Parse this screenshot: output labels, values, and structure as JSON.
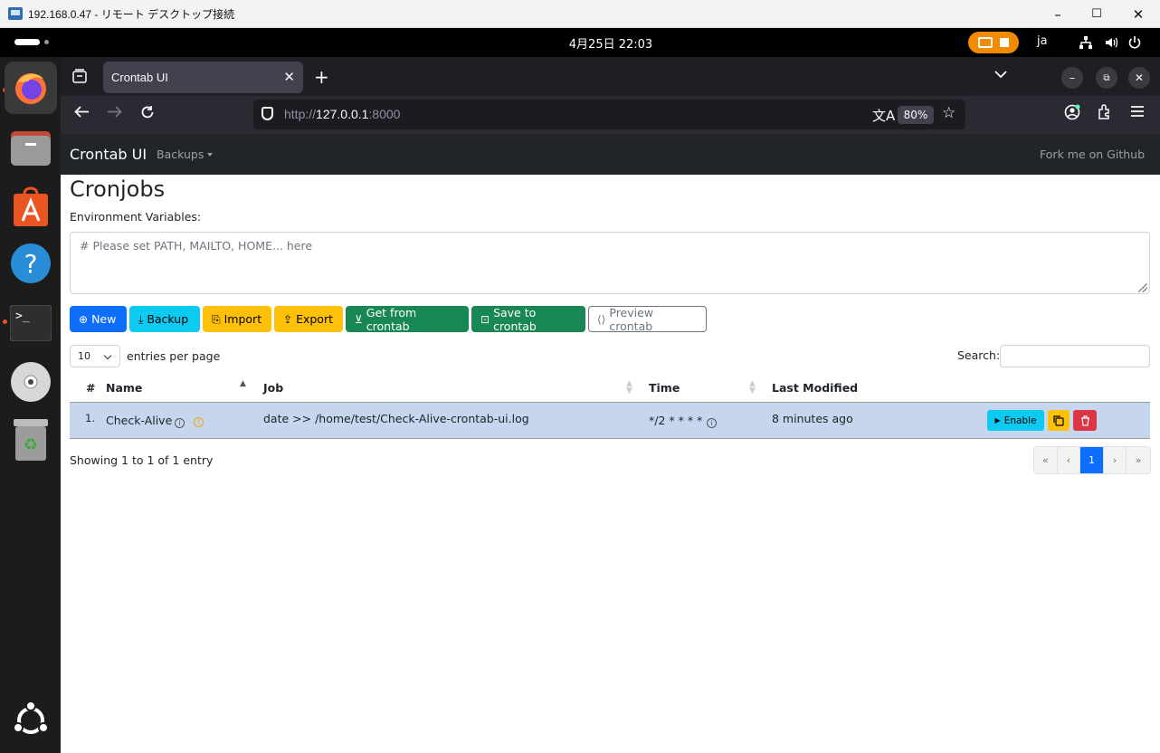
{
  "window": {
    "title": "192.168.0.47 - リモート デスクトップ接続",
    "controls": [
      "–",
      "☐",
      "✕"
    ]
  },
  "topbar": {
    "clock": "4月25日  22:03",
    "lang": "ja"
  },
  "browser": {
    "tab_title": "Crontab UI",
    "url_prefix": "http://",
    "url_host": "127.0.0.1",
    "url_port": ":8000",
    "zoom": "80%"
  },
  "app": {
    "brand": "Crontab UI",
    "backups": "Backups",
    "fork": "Fork me on Github",
    "heading": "Cronjobs",
    "env_label": "Environment Variables:",
    "env_placeholder": "# Please set PATH, MAILTO, HOME... here",
    "buttons": {
      "new": "New",
      "backup": "Backup",
      "import": "Import",
      "export": "Export",
      "get": "Get from crontab",
      "save": "Save to crontab",
      "preview": "Preview crontab"
    },
    "page_length": "10",
    "entries_label": "entries per page",
    "search_label": "Search:",
    "columns": {
      "num": "#",
      "name": "Name",
      "job": "Job",
      "time": "Time",
      "modified": "Last Modified"
    },
    "rows": [
      {
        "num": "1.",
        "name": "Check-Alive",
        "job": "date >> /home/test/Check-Alive-crontab-ui.log",
        "time": "*/2 * * * *",
        "modified": "8 minutes ago",
        "enable": "Enable"
      }
    ],
    "showing": "Showing 1 to 1 of 1 entry",
    "pager": [
      "«",
      "‹",
      "1",
      "›",
      "»"
    ]
  }
}
